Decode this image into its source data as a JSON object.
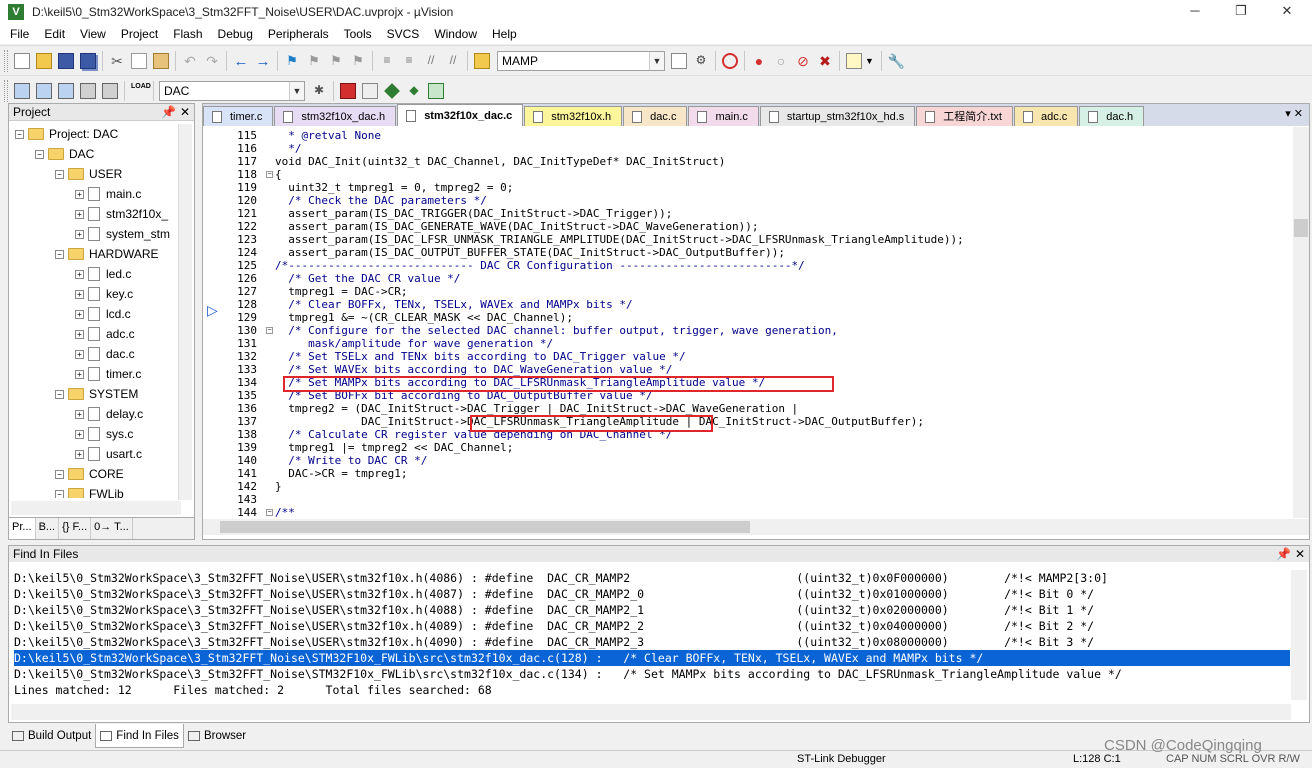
{
  "title": "D:\\keil5\\0_Stm32WorkSpace\\3_Stm32FFT_Noise\\USER\\DAC.uvprojx - µVision",
  "window_buttons": [
    "─",
    "❐",
    "✕"
  ],
  "menu": [
    "File",
    "Edit",
    "View",
    "Project",
    "Flash",
    "Debug",
    "Peripherals",
    "Tools",
    "SVCS",
    "Window",
    "Help"
  ],
  "toolbar1": {
    "target": "MAMP"
  },
  "toolbar2": {
    "target": "DAC"
  },
  "project": {
    "header": "Project",
    "items": [
      {
        "label": "Project: DAC",
        "type": "root"
      },
      {
        "label": "DAC",
        "type": "folder"
      },
      {
        "label": "USER",
        "type": "folder"
      },
      {
        "label": "main.c",
        "type": "file"
      },
      {
        "label": "stm32f10x_",
        "type": "file"
      },
      {
        "label": "system_stm",
        "type": "file"
      },
      {
        "label": "HARDWARE",
        "type": "folder"
      },
      {
        "label": "led.c",
        "type": "file"
      },
      {
        "label": "key.c",
        "type": "file"
      },
      {
        "label": "lcd.c",
        "type": "file"
      },
      {
        "label": "adc.c",
        "type": "file"
      },
      {
        "label": "dac.c",
        "type": "file"
      },
      {
        "label": "timer.c",
        "type": "file"
      },
      {
        "label": "SYSTEM",
        "type": "folder"
      },
      {
        "label": "delay.c",
        "type": "file"
      },
      {
        "label": "sys.c",
        "type": "file"
      },
      {
        "label": "usart.c",
        "type": "file"
      },
      {
        "label": "CORE",
        "type": "folder"
      },
      {
        "label": "FWLib",
        "type": "folder"
      }
    ],
    "tabs": [
      "Pr...",
      "B...",
      "{} F...",
      "0→ T..."
    ]
  },
  "editor_tabs": [
    {
      "label": "timer.c",
      "color": "#d9e3f7"
    },
    {
      "label": "stm32f10x_dac.h",
      "color": "#e6dcf3"
    },
    {
      "label": "stm32f10x_dac.c",
      "color": "#ffffff",
      "active": true
    },
    {
      "label": "stm32f10x.h",
      "color": "#fbf59b"
    },
    {
      "label": "dac.c",
      "color": "#f7e6c8"
    },
    {
      "label": "main.c",
      "color": "#f2dceb"
    },
    {
      "label": "startup_stm32f10x_hd.s",
      "color": "#e8e8e8"
    },
    {
      "label": "工程简介.txt",
      "color": "#f9d6d6"
    },
    {
      "label": "adc.c",
      "color": "#f7e6b0"
    },
    {
      "label": "dac.h",
      "color": "#d6f0e6"
    }
  ],
  "code": [
    {
      "n": "115",
      "t": "  * @retval None",
      "c": "cm"
    },
    {
      "n": "116",
      "t": "  */",
      "c": "cm"
    },
    {
      "n": "117",
      "t": "void DAC_Init(uint32_t DAC_Channel, DAC_InitTypeDef* DAC_InitStruct)",
      "c": ""
    },
    {
      "n": "118",
      "t": "{",
      "c": ""
    },
    {
      "n": "119",
      "t": "  uint32_t tmpreg1 = 0, tmpreg2 = 0;",
      "c": ""
    },
    {
      "n": "120",
      "t": "  /* Check the DAC parameters */",
      "c": "cm"
    },
    {
      "n": "121",
      "t": "  assert_param(IS_DAC_TRIGGER(DAC_InitStruct->DAC_Trigger));",
      "c": ""
    },
    {
      "n": "122",
      "t": "  assert_param(IS_DAC_GENERATE_WAVE(DAC_InitStruct->DAC_WaveGeneration));",
      "c": ""
    },
    {
      "n": "123",
      "t": "  assert_param(IS_DAC_LFSR_UNMASK_TRIANGLE_AMPLITUDE(DAC_InitStruct->DAC_LFSRUnmask_TriangleAmplitude));",
      "c": ""
    },
    {
      "n": "124",
      "t": "  assert_param(IS_DAC_OUTPUT_BUFFER_STATE(DAC_InitStruct->DAC_OutputBuffer));",
      "c": ""
    },
    {
      "n": "125",
      "t": "/*---------------------------- DAC CR Configuration --------------------------*/",
      "c": "cm"
    },
    {
      "n": "126",
      "t": "  /* Get the DAC CR value */",
      "c": "cm"
    },
    {
      "n": "127",
      "t": "  tmpreg1 = DAC->CR;",
      "c": ""
    },
    {
      "n": "128",
      "t": "  /* Clear BOFFx, TENx, TSELx, WAVEx and MAMPx bits */",
      "c": "cm"
    },
    {
      "n": "129",
      "t": "  tmpreg1 &= ~(CR_CLEAR_MASK << DAC_Channel);",
      "c": ""
    },
    {
      "n": "130",
      "t": "  /* Configure for the selected DAC channel: buffer output, trigger, wave generation,",
      "c": "cm"
    },
    {
      "n": "131",
      "t": "     mask/amplitude for wave generation */",
      "c": "cm"
    },
    {
      "n": "132",
      "t": "  /* Set TSELx and TENx bits according to DAC_Trigger value */",
      "c": "cm"
    },
    {
      "n": "133",
      "t": "  /* Set WAVEx bits according to DAC_WaveGeneration value */",
      "c": "cm"
    },
    {
      "n": "134",
      "t": "  /* Set MAMPx bits according to DAC_LFSRUnmask_TriangleAmplitude value */",
      "c": "cm"
    },
    {
      "n": "135",
      "t": "  /* Set BOFFx bit according to DAC_OutputBuffer value */",
      "c": "cm"
    },
    {
      "n": "136",
      "t": "  tmpreg2 = (DAC_InitStruct->DAC_Trigger | DAC_InitStruct->DAC_WaveGeneration |",
      "c": ""
    },
    {
      "n": "137",
      "t": "             DAC_InitStruct->DAC_LFSRUnmask_TriangleAmplitude | DAC_InitStruct->DAC_OutputBuffer);",
      "c": ""
    },
    {
      "n": "138",
      "t": "  /* Calculate CR register value depending on DAC_Channel */",
      "c": "cm"
    },
    {
      "n": "139",
      "t": "  tmpreg1 |= tmpreg2 << DAC_Channel;",
      "c": ""
    },
    {
      "n": "140",
      "t": "  /* Write to DAC CR */",
      "c": "cm"
    },
    {
      "n": "141",
      "t": "  DAC->CR = tmpreg1;",
      "c": ""
    },
    {
      "n": "142",
      "t": "}",
      "c": ""
    },
    {
      "n": "143",
      "t": "",
      "c": ""
    },
    {
      "n": "144",
      "t": "/**",
      "c": "cm"
    }
  ],
  "find": {
    "header": "Find In Files",
    "results": [
      "D:\\keil5\\0_Stm32WorkSpace\\3_Stm32FFT_Noise\\USER\\stm32f10x.h(4086) : #define  DAC_CR_MAMP2                        ((uint32_t)0x0F000000)        /*!< MAMP2[3:0]",
      "D:\\keil5\\0_Stm32WorkSpace\\3_Stm32FFT_Noise\\USER\\stm32f10x.h(4087) : #define  DAC_CR_MAMP2_0                      ((uint32_t)0x01000000)        /*!< Bit 0 */",
      "D:\\keil5\\0_Stm32WorkSpace\\3_Stm32FFT_Noise\\USER\\stm32f10x.h(4088) : #define  DAC_CR_MAMP2_1                      ((uint32_t)0x02000000)        /*!< Bit 1 */",
      "D:\\keil5\\0_Stm32WorkSpace\\3_Stm32FFT_Noise\\USER\\stm32f10x.h(4089) : #define  DAC_CR_MAMP2_2                      ((uint32_t)0x04000000)        /*!< Bit 2 */",
      "D:\\keil5\\0_Stm32WorkSpace\\3_Stm32FFT_Noise\\USER\\stm32f10x.h(4090) : #define  DAC_CR_MAMP2_3                      ((uint32_t)0x08000000)        /*!< Bit 3 */",
      "D:\\keil5\\0_Stm32WorkSpace\\3_Stm32FFT_Noise\\STM32F10x_FWLib\\src\\stm32f10x_dac.c(128) :   /* Clear BOFFx, TENx, TSELx, WAVEx and MAMPx bits */",
      "D:\\keil5\\0_Stm32WorkSpace\\3_Stm32FFT_Noise\\STM32F10x_FWLib\\src\\stm32f10x_dac.c(134) :   /* Set MAMPx bits according to DAC_LFSRUnmask_TriangleAmplitude value */",
      "Lines matched: 12      Files matched: 2      Total files searched: 68"
    ],
    "selected": 5
  },
  "bottom_tabs": [
    "Build Output",
    "Find In Files",
    "Browser"
  ],
  "status": {
    "debugger": "ST-Link Debugger",
    "pos": "L:128 C:1",
    "caps": "CAP  NUM  SCRL  OVR  R/W",
    "watermark": "CSDN @CodeQingqing"
  }
}
